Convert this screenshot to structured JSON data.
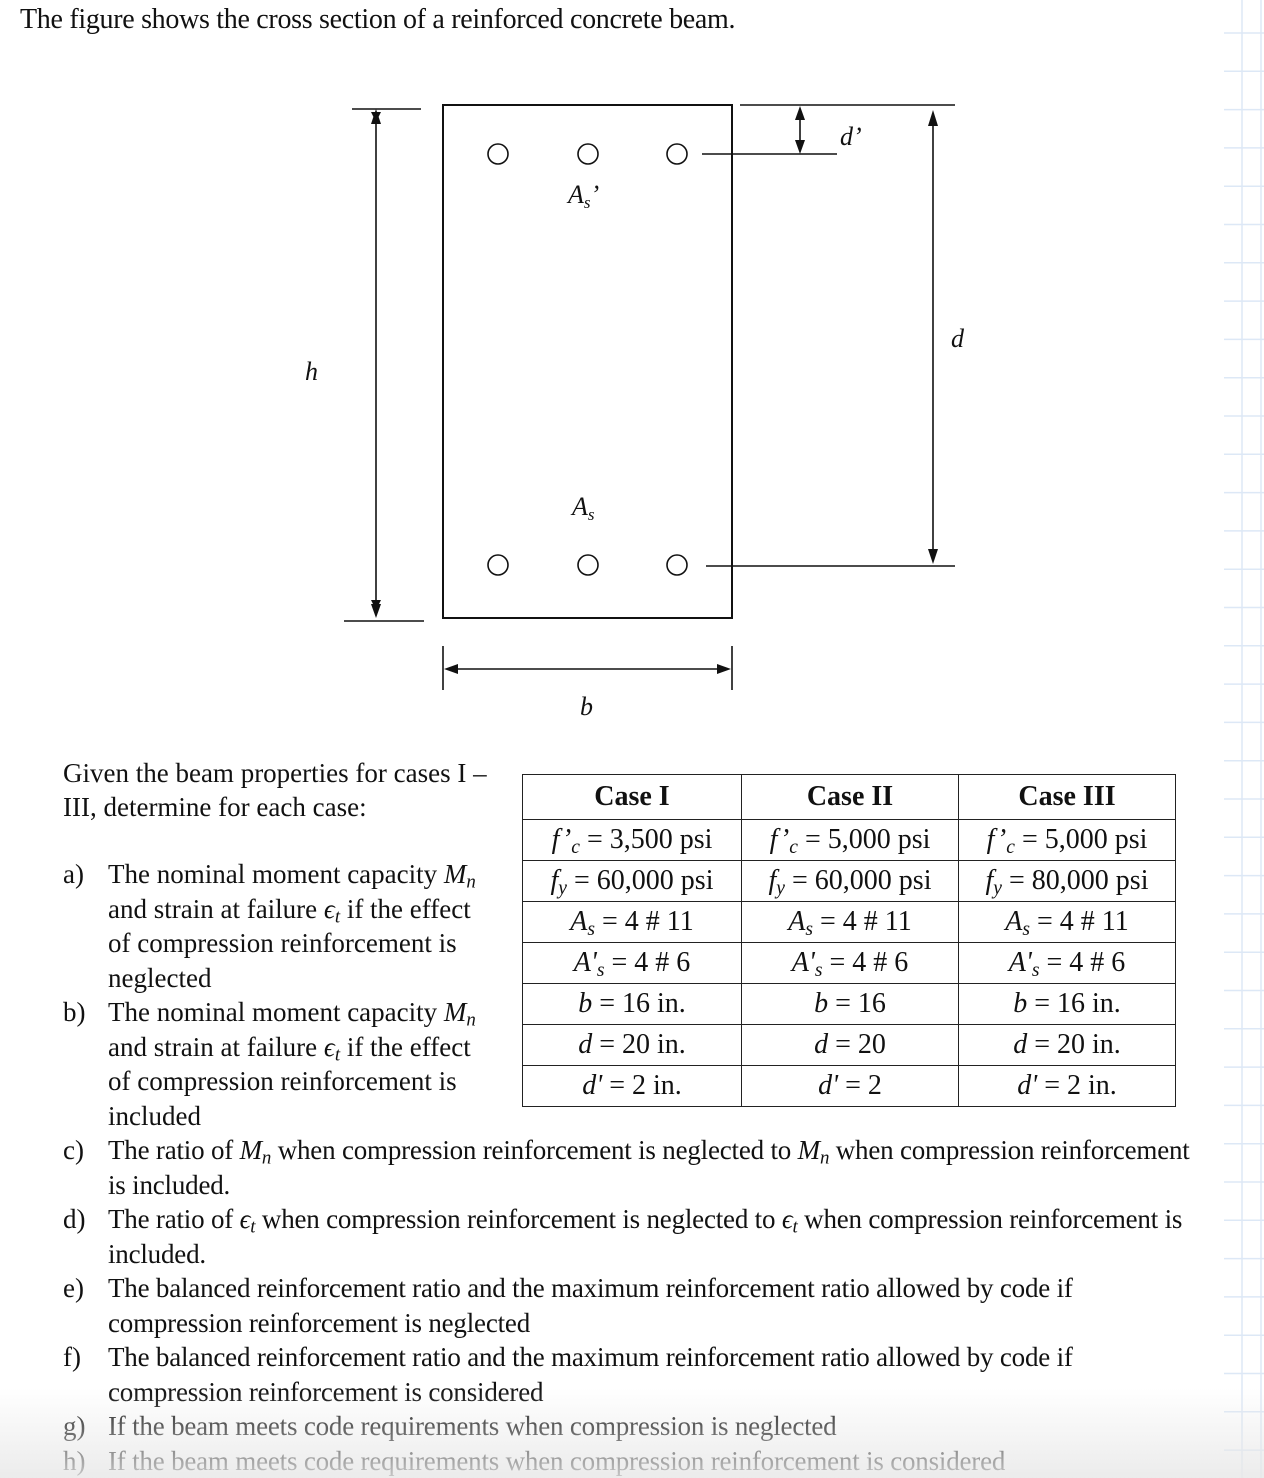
{
  "title": "The figure shows the cross section of a reinforced concrete beam.",
  "figure": {
    "labels": {
      "h": "h",
      "b": "b",
      "d": "d",
      "d_prime": "d’",
      "As_prime": "As’",
      "As": "As"
    },
    "top_bar_count": 3,
    "bottom_bar_count": 3
  },
  "intro": "Given the beam properties for cases I – III, determine for each case:",
  "table": {
    "headers": [
      "Case I",
      "Case II",
      "Case III"
    ],
    "rows": [
      {
        "symbol": "f’c",
        "cells": [
          "3,500 psi",
          "5,000 psi",
          "5,000 psi"
        ]
      },
      {
        "symbol": "fy",
        "cells": [
          "60,000 psi",
          "60,000 psi",
          "80,000 psi"
        ]
      },
      {
        "symbol": "As",
        "cells": [
          "4 # 11",
          "4 # 11",
          "4 # 11"
        ]
      },
      {
        "symbol": "A’s",
        "cells": [
          "4 # 6",
          "4 # 6",
          "4 # 6"
        ]
      },
      {
        "symbol": "b",
        "cells": [
          "16 in.",
          "16",
          "16 in."
        ]
      },
      {
        "symbol": "d",
        "cells": [
          "20 in.",
          "20",
          "20 in."
        ]
      },
      {
        "symbol": "d'",
        "cells": [
          "2 in.",
          "2",
          "2 in."
        ]
      }
    ]
  },
  "questions": [
    {
      "letter": "a)",
      "text": "The nominal moment capacity Mn and strain at failure ϵt if the effect of compression reinforcement is neglected"
    },
    {
      "letter": "b)",
      "text": "The nominal moment capacity Mn and strain at failure ϵt if the effect of compression reinforcement is included"
    },
    {
      "letter": "c)",
      "text": "The ratio of Mn when compression reinforcement is neglected to Mn when compression reinforcement is included."
    },
    {
      "letter": "d)",
      "text": "The ratio of ϵt when compression reinforcement is neglected to ϵt when compression reinforcement is included."
    },
    {
      "letter": "e)",
      "text": "The balanced reinforcement ratio and the maximum reinforcement ratio allowed by code if compression reinforcement is neglected"
    },
    {
      "letter": "f)",
      "text": "The balanced reinforcement ratio and the maximum reinforcement ratio allowed by code if compression reinforcement is considered"
    },
    {
      "letter": "g)",
      "text": "If the beam meets code requirements when compression is neglected"
    },
    {
      "letter": "h)",
      "text": "If the beam meets code requirements when compression reinforcement is considered"
    }
  ]
}
